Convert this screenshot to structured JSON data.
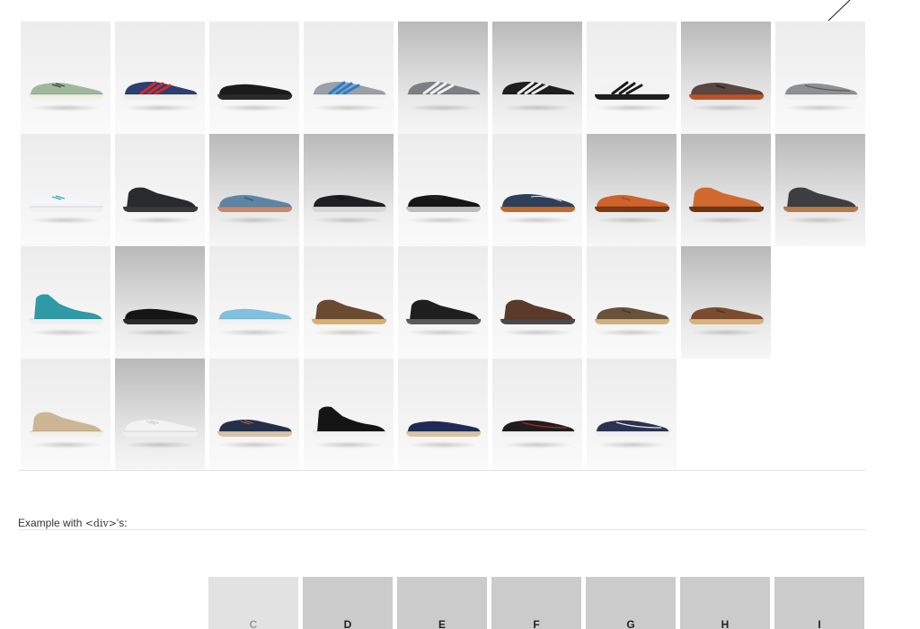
{
  "colors": {
    "tile_bg": "#e6e6e6",
    "div_box_bg": "#cbcbcb",
    "div_box_faded_bg": "#e2e2e2",
    "rule": "#e4e4e4"
  },
  "shoe_grid": {
    "rows": [
      [
        {
          "name": "shoe-sage-canvas-sneaker",
          "tone": "light",
          "upper": "#9fb89c",
          "sole": "#f2efe6",
          "accent": "#2b2b2b",
          "style": "lowtop"
        },
        {
          "name": "shoe-navy-red-runner",
          "tone": "light",
          "upper": "#2d3e70",
          "sole": "#efeee8",
          "accent": "#d22b2b",
          "style": "runner"
        },
        {
          "name": "shoe-black-slipon",
          "tone": "light",
          "upper": "#1b1b1b",
          "sole": "#2a2a2a",
          "accent": "#111111",
          "style": "slipon"
        },
        {
          "name": "shoe-blue-grey-trainer",
          "tone": "light",
          "upper": "#9aa0a6",
          "sole": "#f3f3f3",
          "accent": "#1f7fd8",
          "style": "runner"
        },
        {
          "name": "shoe-grey-white-runner",
          "tone": "dark",
          "upper": "#7d7f82",
          "sole": "#e9e9e9",
          "accent": "#f2f2f2",
          "style": "runner"
        },
        {
          "name": "shoe-black-white-runner",
          "tone": "dark",
          "upper": "#1f1f1f",
          "sole": "#e9e9e9",
          "accent": "#ededed",
          "style": "runner"
        },
        {
          "name": "shoe-white-black-runner",
          "tone": "light",
          "upper": "#f2f2f2",
          "sole": "#1e1e1e",
          "accent": "#1a1a1a",
          "style": "runner"
        },
        {
          "name": "shoe-brown-black-oxford",
          "tone": "dark",
          "upper": "#5a4540",
          "sole": "#b9542a",
          "accent": "#222222",
          "style": "oxford"
        },
        {
          "name": "shoe-grey-boat-shoe",
          "tone": "light",
          "upper": "#8e9092",
          "sole": "#f0f0f0",
          "accent": "#5a5a5a",
          "style": "boat"
        }
      ],
      [
        {
          "name": "shoe-white-canvas-sneaker",
          "tone": "light",
          "upper": "#f4f5f7",
          "sole": "#f0f0f0",
          "accent": "#1b8fb0",
          "style": "lowtop"
        },
        {
          "name": "shoe-black-chukka",
          "tone": "light",
          "upper": "#2a2b2d",
          "sole": "#3a3a3a",
          "accent": "#1b1b1b",
          "style": "chukka"
        },
        {
          "name": "shoe-blue-suede-derby",
          "tone": "dark",
          "upper": "#5d86a6",
          "sole": "#c38b6a",
          "accent": "#3c5e78",
          "style": "oxford"
        },
        {
          "name": "shoe-black-leather-sneaker",
          "tone": "dark",
          "upper": "#202022",
          "sole": "#d6d6d6",
          "accent": "#0e0e0e",
          "style": "lowtop"
        },
        {
          "name": "shoe-black-canvas-sneaker",
          "tone": "light",
          "upper": "#161616",
          "sole": "#bdbdbd",
          "accent": "#2a2a2a",
          "style": "lowtop"
        },
        {
          "name": "shoe-navy-moccasin",
          "tone": "light",
          "upper": "#2e3f5c",
          "sole": "#c06a2e",
          "accent": "#e7e7e7",
          "style": "moc"
        },
        {
          "name": "shoe-tan-leather-derby",
          "tone": "dark",
          "upper": "#d0632a",
          "sole": "#7a3a16",
          "accent": "#a44a1c",
          "style": "oxford"
        },
        {
          "name": "shoe-tan-leather-chukka",
          "tone": "dark",
          "upper": "#d26a2f",
          "sole": "#6e3513",
          "accent": "#9f4a1b",
          "style": "chukka"
        },
        {
          "name": "shoe-grey-suede-chukka",
          "tone": "dark",
          "upper": "#3c3e42",
          "sole": "#b57a4b",
          "accent": "#2a2a2a",
          "style": "chukka"
        }
      ],
      [
        {
          "name": "shoe-teal-hitop",
          "tone": "light",
          "upper": "#2d9aa6",
          "sole": "#efefef",
          "accent": "#1c6a73",
          "style": "hitop"
        },
        {
          "name": "shoe-black-slipon-yellow",
          "tone": "dark",
          "upper": "#151515",
          "sole": "#2a2a2a",
          "accent": "#c8c13a",
          "style": "slipon"
        },
        {
          "name": "shoe-lightblue-slipon",
          "tone": "light",
          "upper": "#7ec0de",
          "sole": "#f2f2f2",
          "accent": "#4a9ac2",
          "style": "slipon"
        },
        {
          "name": "shoe-brown-desert-boot",
          "tone": "light",
          "upper": "#6b4a32",
          "sole": "#d8b074",
          "accent": "#4d3322",
          "style": "chukka"
        },
        {
          "name": "shoe-black-desert-boot",
          "tone": "light",
          "upper": "#1e1e1e",
          "sole": "#5a5a5a",
          "accent": "#0d0d0d",
          "style": "chukka"
        },
        {
          "name": "shoe-darkbrown-desert-boot",
          "tone": "light",
          "upper": "#5b3a2a",
          "sole": "#4a4a4a",
          "accent": "#3a2418",
          "style": "chukka"
        },
        {
          "name": "shoe-brown-suede-derby",
          "tone": "light",
          "upper": "#6a513b",
          "sole": "#d0b17e",
          "accent": "#4a3626",
          "style": "oxford"
        },
        {
          "name": "shoe-brown-leather-derby",
          "tone": "dark",
          "upper": "#7c4c30",
          "sole": "#d9b27a",
          "accent": "#5a321d",
          "style": "oxford"
        },
        {
          "name": "empty",
          "tone": "empty"
        }
      ],
      [
        {
          "name": "shoe-khaki-midtop",
          "tone": "light",
          "upper": "#cdb595",
          "sole": "#f2efe8",
          "accent": "#a88f70",
          "style": "chukka"
        },
        {
          "name": "shoe-white-canvas-lowtop",
          "tone": "dark",
          "upper": "#f3f3f4",
          "sole": "#f0f0f0",
          "accent": "#c6c6c6",
          "style": "lowtop"
        },
        {
          "name": "shoe-navy-plimsoll",
          "tone": "light",
          "upper": "#24304a",
          "sole": "#d9c3a7",
          "accent": "#c2622a",
          "style": "lowtop"
        },
        {
          "name": "shoe-black-hitop-sneaker",
          "tone": "light",
          "upper": "#151515",
          "sole": "#f3f3f3",
          "accent": "#eaeaea",
          "style": "hitop"
        },
        {
          "name": "shoe-navy-espadrille",
          "tone": "light",
          "upper": "#1f2b55",
          "sole": "#d9c3a3",
          "accent": "#131c3a",
          "style": "slipon"
        },
        {
          "name": "shoe-black-red-boat-shoe",
          "tone": "light",
          "upper": "#1e1e1e",
          "sole": "#f0f0f0",
          "accent": "#b62222",
          "style": "boat"
        },
        {
          "name": "shoe-navy-white-boat-shoe",
          "tone": "light",
          "upper": "#2a3352",
          "sole": "#f0f0f0",
          "accent": "#e6e6e6",
          "style": "boat"
        },
        {
          "name": "empty",
          "tone": "empty"
        },
        {
          "name": "empty",
          "tone": "empty"
        }
      ]
    ]
  },
  "example": {
    "prefix": "Example with ",
    "code": "<div>",
    "suffix": "'s:"
  },
  "div_boxes": [
    {
      "label": "C",
      "faded": true
    },
    {
      "label": "D",
      "faded": false
    },
    {
      "label": "E",
      "faded": false
    },
    {
      "label": "F",
      "faded": false
    },
    {
      "label": "G",
      "faded": false
    },
    {
      "label": "H",
      "faded": false
    },
    {
      "label": "I",
      "faded": false
    }
  ]
}
